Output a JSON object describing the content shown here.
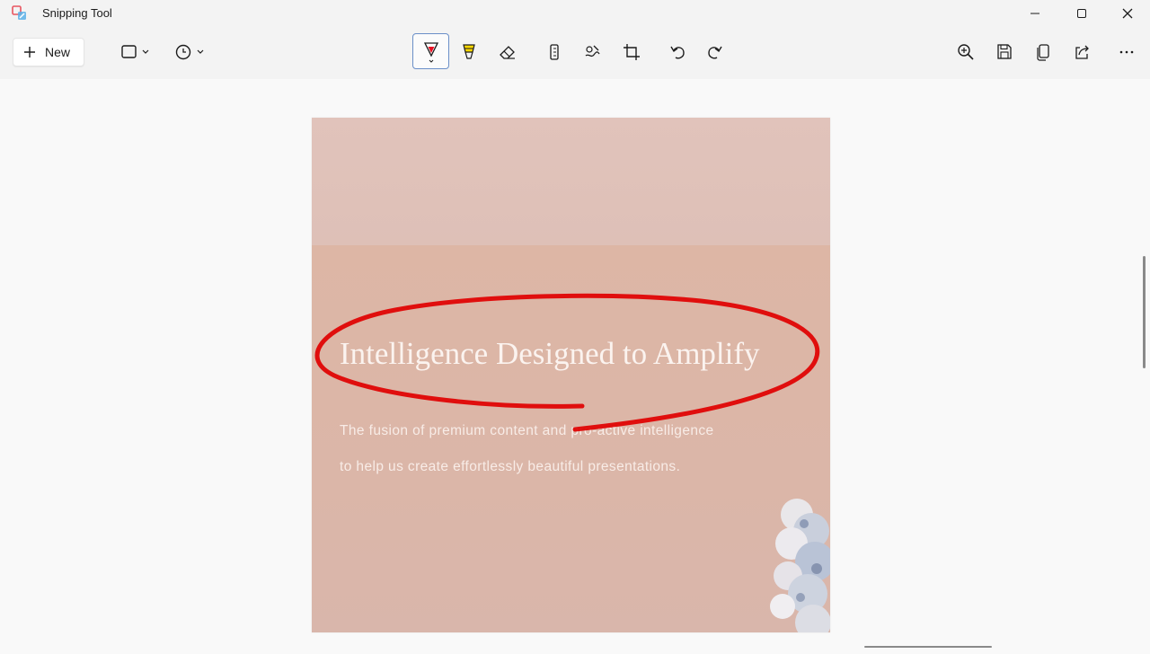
{
  "window": {
    "title": "Snipping Tool"
  },
  "toolbar": {
    "new_label": "New",
    "left_tools": [
      {
        "name": "snip-mode",
        "icon": "rectangle-icon"
      },
      {
        "name": "delay",
        "icon": "clock-icon"
      }
    ],
    "center_tools": [
      {
        "name": "ballpoint-pen",
        "icon": "pen-icon",
        "selected": true,
        "color": "#e81123"
      },
      {
        "name": "highlighter",
        "icon": "highlighter-icon",
        "color": "#ffd800"
      },
      {
        "name": "eraser",
        "icon": "eraser-icon"
      },
      {
        "name": "ruler",
        "icon": "ruler-icon"
      },
      {
        "name": "touch-writing",
        "icon": "touch-writing-icon"
      },
      {
        "name": "crop",
        "icon": "crop-icon"
      },
      {
        "name": "undo",
        "icon": "undo-icon"
      },
      {
        "name": "redo",
        "icon": "redo-icon"
      }
    ],
    "right_tools": [
      {
        "name": "zoom",
        "icon": "zoom-in-icon"
      },
      {
        "name": "save",
        "icon": "save-icon"
      },
      {
        "name": "copy",
        "icon": "copy-icon"
      },
      {
        "name": "share",
        "icon": "share-icon"
      },
      {
        "name": "more",
        "icon": "more-icon"
      }
    ]
  },
  "snip": {
    "headline": "Intelligence Designed to Amplify",
    "body_line_1": "The fusion of premium content and pro-active intelligence",
    "body_line_2": "to help us create effortlessly beautiful presentations.",
    "annotation_color": "#e00000"
  }
}
